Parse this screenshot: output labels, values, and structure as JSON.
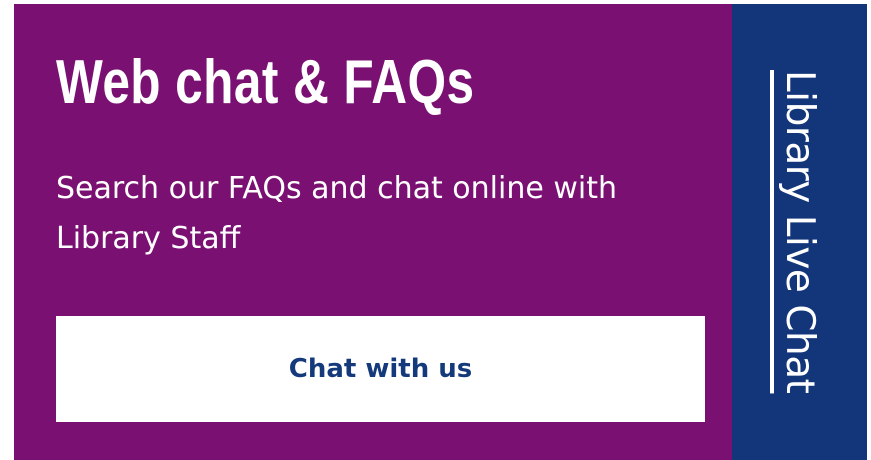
{
  "widget": {
    "title": "Web chat & FAQs",
    "subtitle": "Search our FAQs and chat online with Library Staff",
    "button_label": "Chat with us",
    "side_tab_label": "Library Live Chat",
    "colors": {
      "panel_background": "#7a1072",
      "side_tab_background": "#13357a",
      "button_background": "#ffffff",
      "button_text": "#153a7c",
      "text": "#ffffff"
    }
  }
}
